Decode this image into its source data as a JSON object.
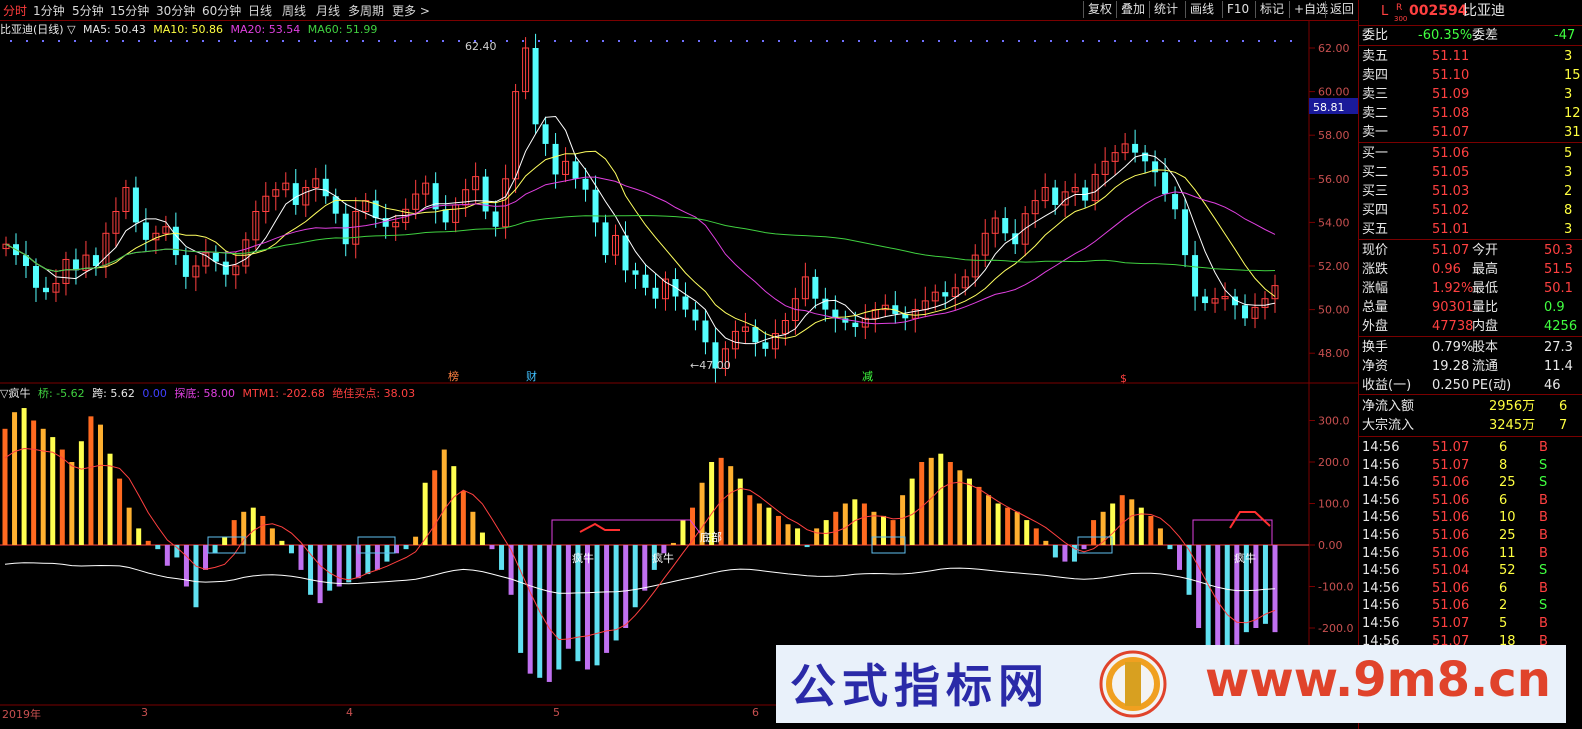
{
  "toolbar": {
    "periods": [
      "分时",
      "1分钟",
      "5分钟",
      "15分钟",
      "30分钟",
      "60分钟",
      "日线",
      "周线",
      "月线",
      "多周期",
      "更多 >"
    ],
    "active": "分时",
    "right_buttons": [
      "复权",
      "叠加",
      "统计",
      "画线",
      "F10",
      "标记",
      "+自选",
      "返回"
    ]
  },
  "ma_bar": {
    "title": "比亚迪(日线) ▽",
    "ma5": "MA5: 50.43",
    "ma10": "MA10: 50.86",
    "ma20": "MA20: 53.54",
    "ma60": "MA60: 51.99"
  },
  "price_axis": {
    "labels": [
      "62.00",
      "60.00",
      "58.00",
      "56.00",
      "54.00",
      "52.00",
      "50.00",
      "48.00"
    ],
    "cursor_value": "58.81"
  },
  "chart_annotations": {
    "high": "62.40",
    "low": "←47.00",
    "events": [
      "榜",
      "财",
      "减",
      "$"
    ]
  },
  "indicator_bar": {
    "name": "▽疯牛",
    "bridge": "桥: -5.62",
    "cross": "跨: 5.62",
    "blank": "0.00",
    "bottom_pick": "探底: 58.00",
    "mtm": "MTM1: -202.68",
    "best_buy": "绝佳买点: 38.03"
  },
  "indicator_axis": [
    "300.0",
    "200.0",
    "100.0",
    "0.00",
    "-100.0",
    "-200.0"
  ],
  "indicator_labels": [
    "疯牛",
    "疯牛",
    "底部",
    "疯牛"
  ],
  "date_axis": [
    "2019年",
    "3",
    "4",
    "5",
    "6"
  ],
  "quote": {
    "code": "002594",
    "name": "比亚迪",
    "flag": "L",
    "r": "R",
    "r_sub": "300",
    "ratio_label": "委比",
    "ratio": "-60.35%",
    "diff_label": "委差",
    "diff": "-47",
    "asks": [
      {
        "label": "卖五",
        "price": "51.11",
        "vol": "3"
      },
      {
        "label": "卖四",
        "price": "51.10",
        "vol": "15"
      },
      {
        "label": "卖三",
        "price": "51.09",
        "vol": "3"
      },
      {
        "label": "卖二",
        "price": "51.08",
        "vol": "12"
      },
      {
        "label": "卖一",
        "price": "51.07",
        "vol": "31"
      }
    ],
    "bids": [
      {
        "label": "买一",
        "price": "51.06",
        "vol": "5"
      },
      {
        "label": "买二",
        "price": "51.05",
        "vol": "3"
      },
      {
        "label": "买三",
        "price": "51.03",
        "vol": "2"
      },
      {
        "label": "买四",
        "price": "51.02",
        "vol": "8"
      },
      {
        "label": "买五",
        "price": "51.01",
        "vol": "3"
      }
    ],
    "stats": [
      {
        "l1": "现价",
        "v1": "51.07",
        "l2": "今开",
        "v2": "50.3"
      },
      {
        "l1": "涨跌",
        "v1": "0.96",
        "l2": "最高",
        "v2": "51.5"
      },
      {
        "l1": "涨幅",
        "v1": "1.92%",
        "l2": "最低",
        "v2": "50.1"
      },
      {
        "l1": "总量",
        "v1": "90301",
        "l2": "量比",
        "v2": "0.9"
      },
      {
        "l1": "外盘",
        "v1": "47738",
        "l2": "内盘",
        "v2": "4256"
      }
    ],
    "stats2": [
      {
        "l1": "换手",
        "v1": "0.79%",
        "l2": "股本",
        "v2": "27.3"
      },
      {
        "l1": "净资",
        "v1": "19.28",
        "l2": "流通",
        "v2": "11.4"
      },
      {
        "l1": "收益(一)",
        "v1": "0.250",
        "l2": "PE(动)",
        "v2": "46"
      }
    ],
    "flows": [
      {
        "label": "净流入额",
        "value": "2956万",
        "extra": "6"
      },
      {
        "label": "大宗流入",
        "value": "3245万",
        "extra": "7"
      }
    ],
    "ticks": [
      {
        "time": "14:56",
        "price": "51.07",
        "vol": "6",
        "side": "B"
      },
      {
        "time": "14:56",
        "price": "51.07",
        "vol": "8",
        "side": "S"
      },
      {
        "time": "14:56",
        "price": "51.06",
        "vol": "25",
        "side": "S"
      },
      {
        "time": "14:56",
        "price": "51.06",
        "vol": "6",
        "side": "B"
      },
      {
        "time": "14:56",
        "price": "51.06",
        "vol": "10",
        "side": "B"
      },
      {
        "time": "14:56",
        "price": "51.06",
        "vol": "25",
        "side": "B"
      },
      {
        "time": "14:56",
        "price": "51.06",
        "vol": "11",
        "side": "B"
      },
      {
        "time": "14:56",
        "price": "51.04",
        "vol": "52",
        "side": "S"
      },
      {
        "time": "14:56",
        "price": "51.06",
        "vol": "6",
        "side": "B"
      },
      {
        "time": "14:56",
        "price": "51.06",
        "vol": "2",
        "side": "S"
      },
      {
        "time": "14:56",
        "price": "51.07",
        "vol": "5",
        "side": "B"
      },
      {
        "time": "14:56",
        "price": "51.07",
        "vol": "18",
        "side": "B"
      }
    ]
  },
  "watermark": {
    "title": "公式指标网",
    "url": "www.9m8.cn"
  },
  "colors": {
    "up": "#ff4040",
    "down": "#54ffff",
    "ma5": "#ffffff",
    "ma10": "#ffff60",
    "ma20": "#e040e0",
    "ma60": "#40d040",
    "axis": "#7a0000"
  }
}
